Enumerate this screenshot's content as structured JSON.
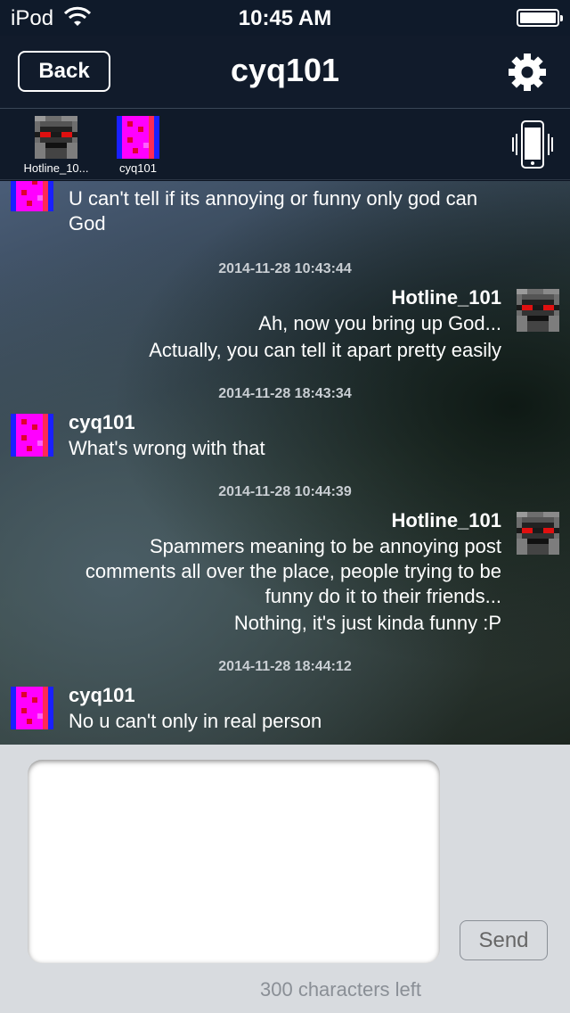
{
  "status_bar": {
    "device": "iPod",
    "time": "10:45 AM"
  },
  "nav": {
    "back_label": "Back",
    "title": "cyq101"
  },
  "participants": [
    {
      "name": "Hotline_10...",
      "avatar": "gray-robot-avatar"
    },
    {
      "name": "cyq101",
      "avatar": "magenta-pixel-avatar"
    }
  ],
  "messages": [
    {
      "side": "left",
      "sender": "",
      "lines": [
        "U can't tell if its annoying or funny only god can",
        "God"
      ]
    },
    {
      "side": "right",
      "timestamp": "2014-11-28 10:43:44",
      "sender": "Hotline_101",
      "lines": [
        "Ah, now you bring up God...",
        "Actually, you can tell it apart pretty easily"
      ]
    },
    {
      "side": "left",
      "timestamp": "2014-11-28 18:43:34",
      "sender": "cyq101",
      "lines": [
        "What's wrong with that"
      ]
    },
    {
      "side": "right",
      "timestamp": "2014-11-28 10:44:39",
      "sender": "Hotline_101",
      "lines": [
        "Spammers meaning to be annoying post",
        "comments all over the place, people trying to be",
        "funny do it to their friends...",
        "Nothing, it's just kinda funny :P"
      ]
    },
    {
      "side": "left",
      "timestamp": "2014-11-28 18:44:12",
      "sender": "cyq101",
      "lines": [
        "No u can't only in real person"
      ]
    }
  ],
  "compose": {
    "placeholder": "",
    "send_label": "Send",
    "chars_left": "300 characters left"
  },
  "icons": {
    "wifi": "wifi-icon",
    "battery": "battery-icon",
    "settings": "gear-icon",
    "vibrate": "phone-vibrate-icon"
  },
  "colors": {
    "nav_background": "#111b2b",
    "compose_background": "#d8dbdf",
    "magenta_avatar": "#ff00ff",
    "robot_eye": "#e01010"
  }
}
